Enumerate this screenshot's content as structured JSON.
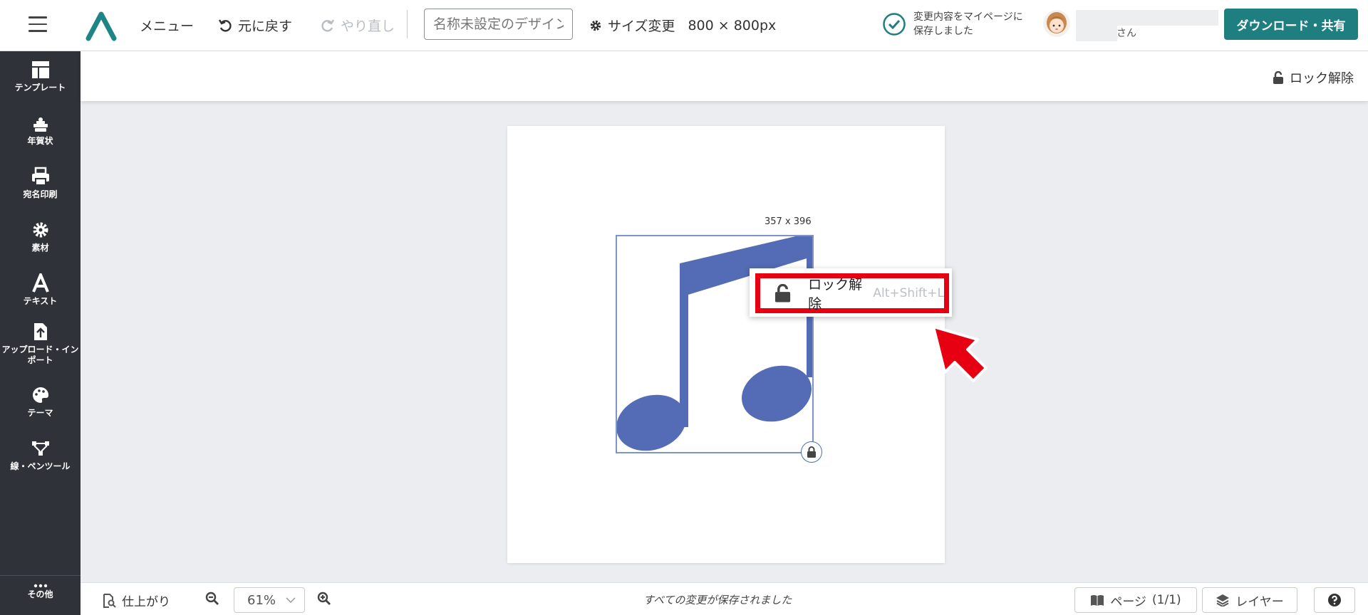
{
  "header": {
    "menu_label": "メニュー",
    "undo_label": "元に戻す",
    "redo_label": "やり直し",
    "design_name_placeholder": "名称未設定のデザイン",
    "size_change_label": "サイズ変更",
    "size_value": "800 × 800px",
    "save_status": "変更内容をマイページに保存しました",
    "user_suffix": "さん",
    "download_label": "ダウンロード・共有"
  },
  "sidebar": {
    "items": [
      {
        "label": "テンプレート",
        "icon": "template-icon"
      },
      {
        "label": "年賀状",
        "icon": "new-year-card-icon"
      },
      {
        "label": "宛名印刷",
        "icon": "printer-icon"
      },
      {
        "label": "素材",
        "icon": "materials-icon"
      },
      {
        "label": "テキスト",
        "icon": "text-icon"
      },
      {
        "label": "アップロード・インポート",
        "icon": "upload-icon"
      },
      {
        "label": "テーマ",
        "icon": "palette-icon"
      },
      {
        "label": "線・ペンツール",
        "icon": "pen-tool-icon"
      }
    ],
    "more_label": "その他"
  },
  "subbar": {
    "unlock_label": "ロック解除"
  },
  "canvas": {
    "selection_dims": "357 x 396",
    "note_color": "#546bb5"
  },
  "context_menu": {
    "label": "ロック解除",
    "shortcut": "Alt+Shift+L"
  },
  "bottombar": {
    "finish_label": "仕上がり",
    "zoom_value": "61%",
    "status": "すべての変更が保存されました",
    "page_label": "ページ",
    "page_count": "(1/1)",
    "layer_label": "レイヤー"
  },
  "colors": {
    "accent": "#1e7e80",
    "sidebar_bg": "#2f3239",
    "highlight_red": "#e60012"
  }
}
